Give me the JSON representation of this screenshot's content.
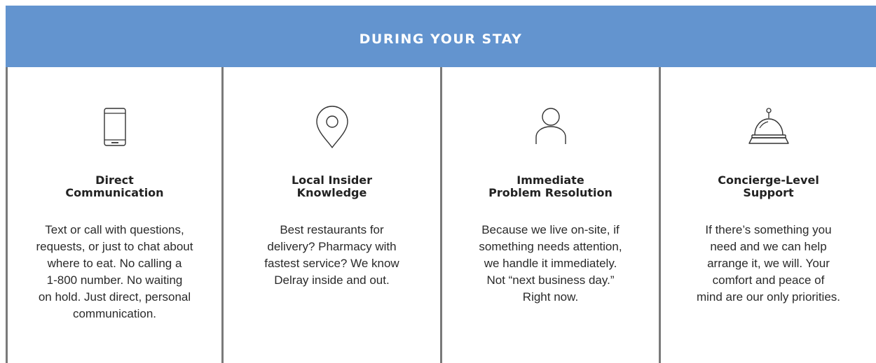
{
  "banner": {
    "title": "DURING YOUR STAY",
    "color": "#6394cf"
  },
  "columns": [
    {
      "icon": "smartphone-icon",
      "title": "Direct\nCommunication",
      "description": "Text or call with questions,\nrequests, or just to chat about\nwhere to eat. No calling a\n1-800 number. No waiting\non hold. Just direct, personal\ncommunication."
    },
    {
      "icon": "map-pin-icon",
      "title": "Local  Insider\nKnowledge",
      "description": "Best restaurants for\ndelivery? Pharmacy with\nfastest service? We know\nDelray inside and out."
    },
    {
      "icon": "person-icon",
      "title": "Immediate\nProblem Resolution",
      "description": "Because we live on-site, if\nsomething needs attention,\nwe handle it immediately.\nNot “next business day.”\nRight now."
    },
    {
      "icon": "service-bell-icon",
      "title": "Concierge-Level\nSupport",
      "description": "If there’s something you\nneed and we can help\narrange it, we will. Your\ncomfort and peace of\nmind are our only priorities."
    }
  ]
}
